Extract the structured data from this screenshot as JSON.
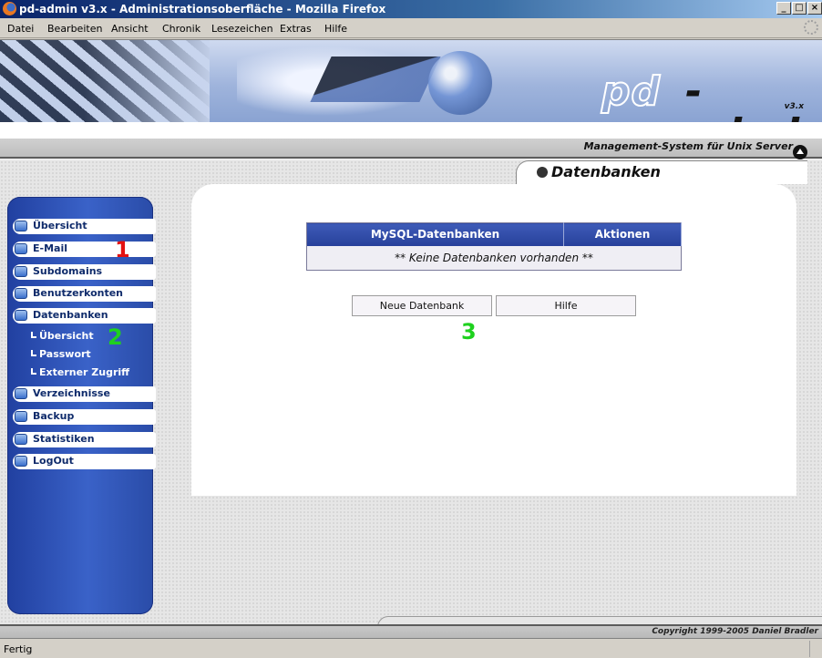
{
  "window": {
    "title": "pd-admin v3.x - Administrationsoberfläche - Mozilla Firefox",
    "minimize": "_",
    "maximize": "□",
    "close": "×"
  },
  "menubar": {
    "items": [
      "Datei",
      "Bearbeiten",
      "Ansicht",
      "Chronik",
      "Lesezeichen",
      "Extras",
      "Hilfe"
    ]
  },
  "header": {
    "logo_pd": "pd",
    "logo_admin": "-admin",
    "logo_version": "v3.x",
    "tagline": "Management-System für Unix Server"
  },
  "sidebar": {
    "items": [
      {
        "label": "Übersicht"
      },
      {
        "label": "E-Mail"
      },
      {
        "label": "Subdomains"
      },
      {
        "label": "Benutzerkonten"
      },
      {
        "label": "Datenbanken"
      },
      {
        "label": "Verzeichnisse"
      },
      {
        "label": "Backup"
      },
      {
        "label": "Statistiken"
      },
      {
        "label": "LogOut"
      }
    ],
    "subitems": [
      {
        "label": "Übersicht"
      },
      {
        "label": "Passwort"
      },
      {
        "label": "Externer Zugriff"
      }
    ]
  },
  "markers": {
    "one": "1",
    "two": "2",
    "three": "3"
  },
  "main": {
    "section_title": "Datenbanken",
    "table": {
      "headers": [
        "MySQL-Datenbanken",
        "Aktionen"
      ],
      "empty_text": "** Keine Datenbanken vorhanden **"
    },
    "buttons": {
      "new_db": "Neue Datenbank",
      "help": "Hilfe"
    }
  },
  "footer": {
    "copyright": "Copyright 1999-2005 Daniel Bradler"
  },
  "statusbar": {
    "text": "Fertig"
  },
  "colors": {
    "sidebar_blue": "#3a62c8",
    "table_header_blue": "#27409a",
    "marker_red": "#e41111",
    "marker_green": "#1fd11f"
  }
}
